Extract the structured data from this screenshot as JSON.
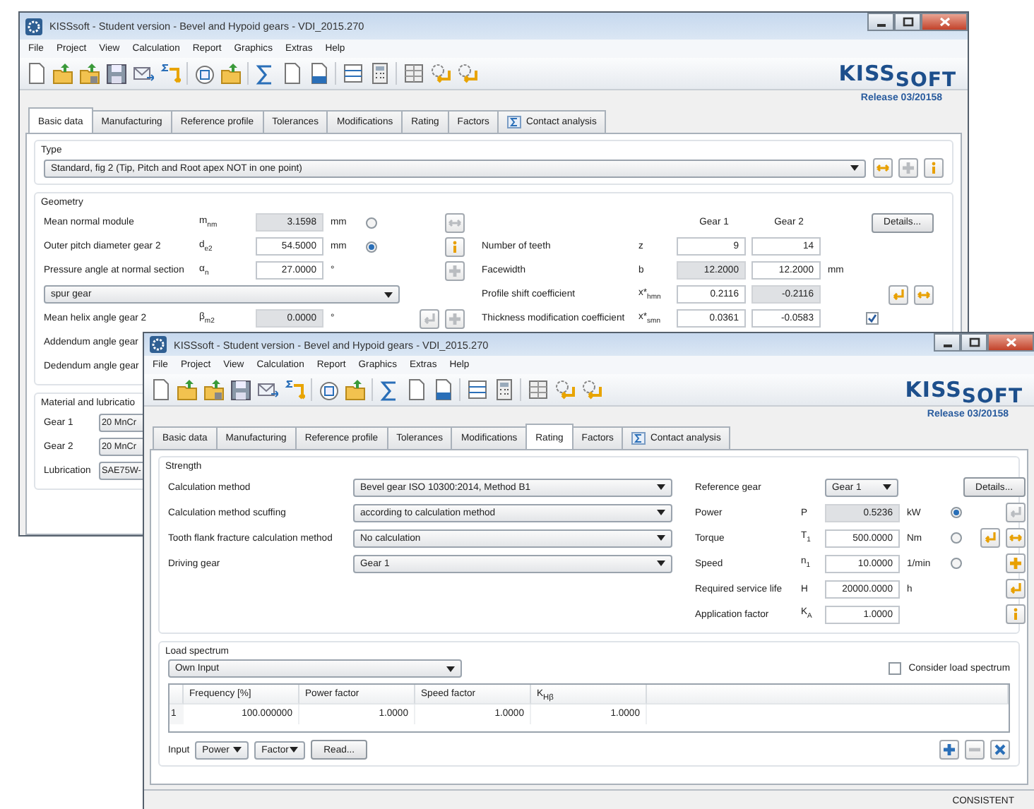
{
  "back_window": {
    "title": "KISSsoft - Student version - Bevel and Hypoid gears - VDI_2015.270",
    "menu": [
      "File",
      "Project",
      "View",
      "Calculation",
      "Report",
      "Graphics",
      "Extras",
      "Help"
    ],
    "logo": [
      "KISS",
      "SOFT"
    ],
    "release": "Release 03/20158",
    "tabs": [
      {
        "label": "Basic data",
        "selected": true,
        "kind": "plain"
      },
      {
        "label": "Manufacturing",
        "selected": false,
        "kind": "plain"
      },
      {
        "label": "Reference profile",
        "selected": false,
        "kind": "plain"
      },
      {
        "label": "Tolerances",
        "selected": false,
        "kind": "plain"
      },
      {
        "label": "Modifications",
        "selected": false,
        "kind": "plain"
      },
      {
        "label": "Rating",
        "selected": false,
        "kind": "plain"
      },
      {
        "label": "Factors",
        "selected": false,
        "kind": "plain"
      },
      {
        "label": "Contact analysis",
        "selected": false,
        "kind": "sigma"
      }
    ],
    "type_group": {
      "label": "Type",
      "value": "Standard, fig 2 (Tip, Pitch and Root apex NOT in one point)",
      "tools": [
        {
          "kind": "swap",
          "disabled": false
        },
        {
          "kind": "plus",
          "disabled": true
        },
        {
          "kind": "info",
          "disabled": false
        }
      ]
    },
    "geometry": {
      "label": "Geometry",
      "left_rows": [
        {
          "kind": "field",
          "label": "Mean normal module",
          "symbol": {
            "base": "m",
            "sub": "nm"
          },
          "value": "3.1598",
          "editable": false,
          "unit": "mm",
          "radio": {
            "selected": false
          },
          "tools": [
            {
              "kind": "swap",
              "disabled": true
            }
          ]
        },
        {
          "kind": "field",
          "label": "Outer pitch diameter gear 2",
          "symbol": {
            "base": "d",
            "sub": "e2"
          },
          "value": "54.5000",
          "editable": true,
          "unit": "mm",
          "radio": {
            "selected": true
          },
          "tools": [
            {
              "kind": "info",
              "disabled": false
            }
          ]
        },
        {
          "kind": "field",
          "label": "Pressure angle at normal section",
          "symbol": {
            "base": "α",
            "sub": "n"
          },
          "value": "27.0000",
          "editable": true,
          "unit": "°",
          "tools": [
            {
              "kind": "plus",
              "disabled": true
            }
          ]
        },
        {
          "kind": "combo",
          "value": "spur gear"
        },
        {
          "kind": "field",
          "label": "Mean helix angle gear 2",
          "symbol": {
            "base": "β",
            "sub": "m2"
          },
          "value": "0.0000",
          "editable": false,
          "unit": "°",
          "tools": [
            {
              "kind": "arrow",
              "disabled": true
            },
            {
              "kind": "plus",
              "disabled": true
            }
          ]
        },
        {
          "kind": "label",
          "label": "Addendum angle gear"
        },
        {
          "kind": "label",
          "label": "Dedendum angle gear"
        }
      ],
      "columns": [
        "Gear 1",
        "Gear 2"
      ],
      "details_button": "Details...",
      "right_rows": [
        {
          "label": "Number of teeth",
          "symbol": {
            "base": "z"
          },
          "values": [
            {
              "value": "9",
              "editable": true
            },
            {
              "value": "14",
              "editable": true
            }
          ]
        },
        {
          "label": "Facewidth",
          "symbol": {
            "base": "b"
          },
          "values": [
            {
              "value": "12.2000",
              "editable": false
            },
            {
              "value": "12.2000",
              "editable": true
            }
          ],
          "unit": "mm"
        },
        {
          "label": "Profile shift coefficient",
          "symbol": {
            "base": "x*",
            "sub": "hmn"
          },
          "values": [
            {
              "value": "0.2116",
              "editable": true
            },
            {
              "value": "-0.2116",
              "editable": false
            }
          ],
          "tools": [
            {
              "kind": "arrow",
              "disabled": false
            },
            {
              "kind": "swap",
              "disabled": false
            }
          ]
        },
        {
          "label": "Thickness modification coefficient",
          "symbol": {
            "base": "x*",
            "sub": "smn"
          },
          "values": [
            {
              "value": "0.0361",
              "editable": true
            },
            {
              "value": "-0.0583",
              "editable": true
            }
          ],
          "checkbox": {
            "checked": true
          }
        }
      ]
    },
    "material": {
      "label": "Material and lubricatio",
      "rows": [
        {
          "label": "Gear 1",
          "value": "20 MnCr"
        },
        {
          "label": "Gear 2",
          "value": "20 MnCr"
        },
        {
          "label": "Lubrication",
          "value": "SAE75W-"
        }
      ]
    }
  },
  "front_window": {
    "title": "KISSsoft - Student version - Bevel and Hypoid gears - VDI_2015.270",
    "menu": [
      "File",
      "Project",
      "View",
      "Calculation",
      "Report",
      "Graphics",
      "Extras",
      "Help"
    ],
    "logo": [
      "KISS",
      "SOFT"
    ],
    "release": "Release 03/20158",
    "tabs": [
      {
        "label": "Basic data",
        "selected": false,
        "kind": "plain"
      },
      {
        "label": "Manufacturing",
        "selected": false,
        "kind": "plain"
      },
      {
        "label": "Reference profile",
        "selected": false,
        "kind": "plain"
      },
      {
        "label": "Tolerances",
        "selected": false,
        "kind": "plain"
      },
      {
        "label": "Modifications",
        "selected": false,
        "kind": "plain"
      },
      {
        "label": "Rating",
        "selected": true,
        "kind": "plain"
      },
      {
        "label": "Factors",
        "selected": false,
        "kind": "plain"
      },
      {
        "label": "Contact analysis",
        "selected": false,
        "kind": "sigma"
      }
    ],
    "strength": {
      "label": "Strength",
      "left_rows": [
        {
          "label": "Calculation method",
          "value": "Bevel gear ISO 10300:2014, Method B1"
        },
        {
          "label": "Calculation method scuffing",
          "value": "according to calculation method"
        },
        {
          "label": "Tooth flank fracture calculation method",
          "value": "No calculation"
        },
        {
          "label": "Driving gear",
          "value": "Gear 1"
        }
      ],
      "reference": {
        "label": "Reference gear",
        "value": "Gear 1"
      },
      "details_button": "Details...",
      "right_rows": [
        {
          "label": "Power",
          "symbol": {
            "base": "P"
          },
          "value": "0.5236",
          "editable": false,
          "unit": "kW",
          "radio": {
            "selected": true
          },
          "tools": [
            {
              "kind": "arrow",
              "disabled": true
            }
          ]
        },
        {
          "label": "Torque",
          "symbol": {
            "base": "T",
            "sub": "1"
          },
          "value": "500.0000",
          "editable": true,
          "unit": "Nm",
          "radio": {
            "selected": false
          },
          "tools": [
            {
              "kind": "arrow",
              "disabled": false
            },
            {
              "kind": "swap",
              "disabled": false
            }
          ]
        },
        {
          "label": "Speed",
          "symbol": {
            "base": "n",
            "sub": "1"
          },
          "value": "10.0000",
          "editable": true,
          "unit": "1/min",
          "radio": {
            "selected": false
          },
          "tools": [
            {
              "kind": "plus",
              "disabled": false
            }
          ]
        },
        {
          "label": "Required service life",
          "symbol": {
            "base": "H"
          },
          "value": "20000.0000",
          "editable": true,
          "unit": "h",
          "tools": [
            {
              "kind": "arrow",
              "disabled": false
            }
          ]
        },
        {
          "label": "Application factor",
          "symbol": {
            "base": "K",
            "sub": "A"
          },
          "value": "1.0000",
          "editable": true,
          "tools": [
            {
              "kind": "info",
              "disabled": false
            }
          ]
        }
      ]
    },
    "load_spectrum": {
      "label": "Load spectrum",
      "mode": "Own Input",
      "consider": {
        "label": "Consider load spectrum",
        "checked": false
      },
      "table": {
        "columns": [
          {
            "base": "Frequency [%]"
          },
          {
            "base": "Power factor"
          },
          {
            "base": "Speed factor"
          },
          {
            "base": "K",
            "sub": "Hβ"
          }
        ],
        "rows": [
          {
            "number": "1",
            "cells": [
              "100.000000",
              "1.0000",
              "1.0000",
              "1.0000"
            ]
          }
        ]
      },
      "input": {
        "label": "Input",
        "power": "Power",
        "factor": "Factor",
        "read_button": "Read..."
      },
      "tools": [
        {
          "kind": "add",
          "disabled": false
        },
        {
          "kind": "remove",
          "disabled": true
        },
        {
          "kind": "clear",
          "disabled": false
        }
      ]
    },
    "status": "CONSISTENT"
  }
}
